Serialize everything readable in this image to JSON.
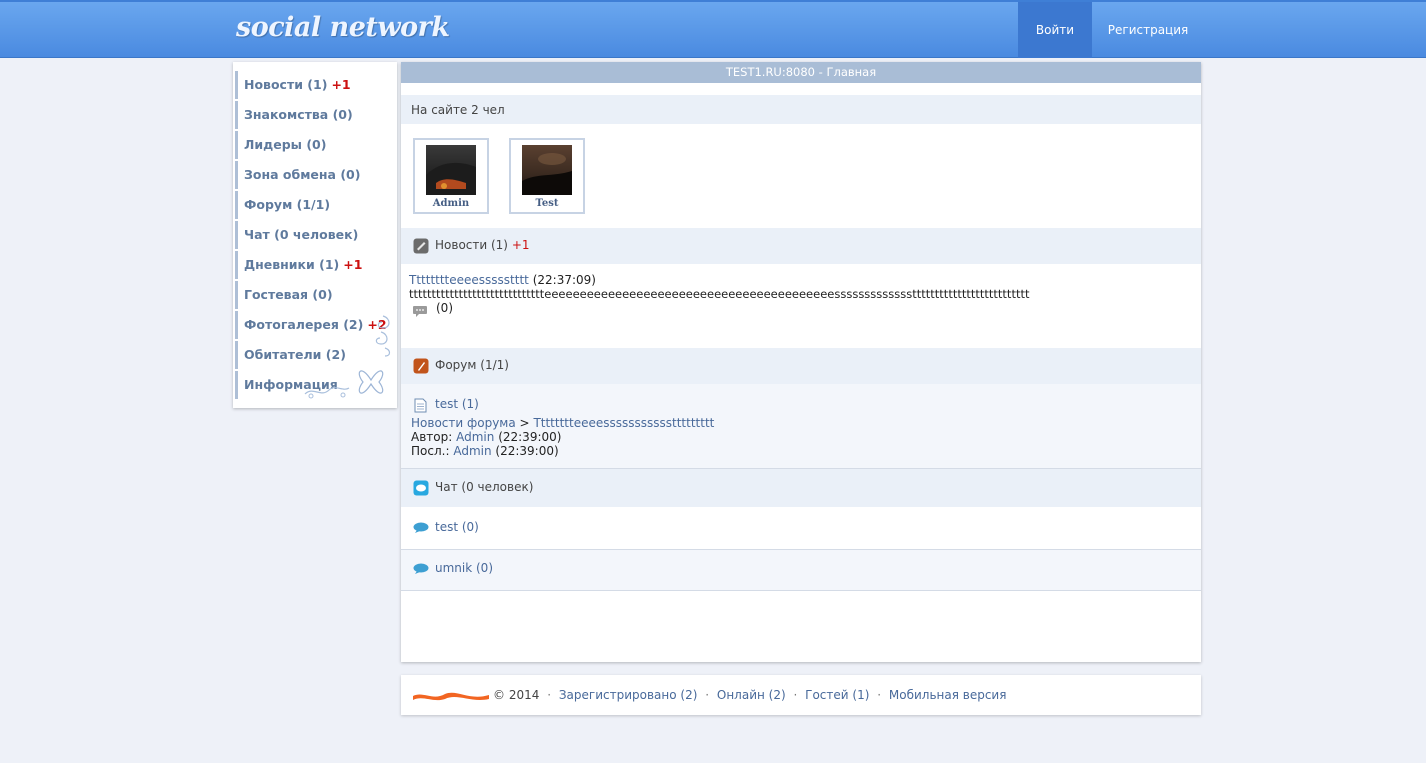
{
  "header": {
    "logo": "social network",
    "login_label": "Войти",
    "register_label": "Регистрация"
  },
  "sidebar": {
    "items": [
      {
        "label": "Новости (1)",
        "badge": "+1"
      },
      {
        "label": "Знакомства (0)",
        "badge": ""
      },
      {
        "label": "Лидеры (0)",
        "badge": ""
      },
      {
        "label": "Зона обмена (0)",
        "badge": ""
      },
      {
        "label": "Форум (1/1)",
        "badge": ""
      },
      {
        "label": "Чат (0 человек)",
        "badge": ""
      },
      {
        "label": "Дневники (1)",
        "badge": "+1"
      },
      {
        "label": "Гостевая (0)",
        "badge": ""
      },
      {
        "label": "Фотогалерея (2)",
        "badge": "+2"
      },
      {
        "label": "Обитатели (2)",
        "badge": ""
      },
      {
        "label": "Информация",
        "badge": ""
      }
    ]
  },
  "main": {
    "title": "TEST1.RU:8080 - Главная",
    "online_text": "На сайте 2 чел",
    "users": [
      {
        "name": "Admin"
      },
      {
        "name": "Test"
      }
    ],
    "news": {
      "title": "Новости (1)",
      "badge": "+1",
      "item_title": "Tttttttteeeessssstttt",
      "item_time": "(22:37:09)",
      "item_body": "tttttttttttttttttttttttttttttteeeeeeeeeeeeeeeeeeeeeeeeeeeeeeeeeeeeeeeeessssssssssssstttttttttttttttttttttttttt",
      "comments": "(0)"
    },
    "forum": {
      "title": "Форум (1/1)",
      "topic": "test (1)",
      "crumb_section": "Новости форума",
      "crumb_sep": ">",
      "crumb_topic": "Tttttttteeeesssssssssssttttttttt",
      "author_label": "Автор:",
      "author_name": "Admin",
      "author_time": "(22:39:00)",
      "last_label": "Посл.:",
      "last_name": "Admin",
      "last_time": "(22:39:00)"
    },
    "chat": {
      "title": "Чат (0 человек)",
      "rooms": [
        {
          "label": "test (0)"
        },
        {
          "label": "umnik (0)"
        }
      ]
    }
  },
  "footer": {
    "copyright": "© 2014",
    "registered": "Зарегистрировано (2)",
    "online": "Онлайн (2)",
    "guests": "Гостей (1)",
    "mobile": "Мобильная версия",
    "separator": "·"
  },
  "colors": {
    "header_blue": "#4a8ae0",
    "active_nav": "#3c78d0",
    "badge_red": "#c11111",
    "link_blue": "#48699a",
    "band_bg": "#eaf0f8"
  }
}
